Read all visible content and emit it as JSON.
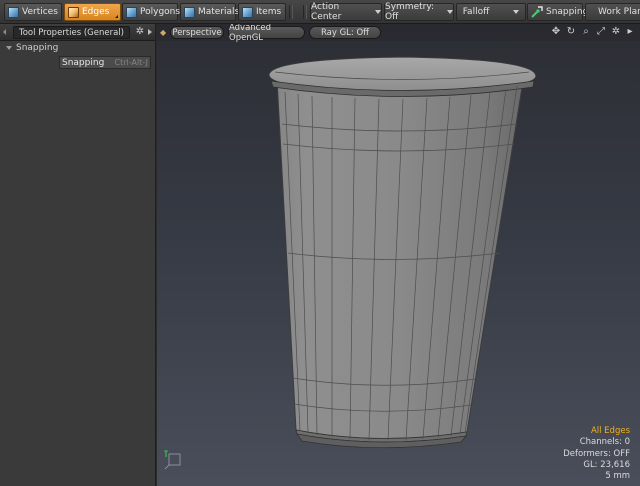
{
  "toolbar": {
    "modes": [
      {
        "label": "Vertices",
        "icon": "vertices-mode-icon",
        "active": false
      },
      {
        "label": "Edges",
        "icon": "edges-mode-icon",
        "active": true
      },
      {
        "label": "Polygons",
        "icon": "polygons-mode-icon",
        "active": false
      },
      {
        "label": "Materials",
        "icon": "materials-mode-icon",
        "active": false
      },
      {
        "label": "Items",
        "icon": "items-mode-icon",
        "active": false
      }
    ],
    "action_center": "Action Center",
    "symmetry": "Symmetry: Off",
    "falloff": "Falloff",
    "snapping": "Snapping",
    "work_plane": "Work Plane"
  },
  "panel": {
    "title": "Tool Properties (General)",
    "section": "Snapping",
    "row_label": "Snapping",
    "row_shortcut": "Ctrl-Alt-J"
  },
  "viewport": {
    "view": "Perspective",
    "shading": "Advanced OpenGL",
    "raygl": "Ray GL: Off",
    "stats": {
      "title": "All Edges",
      "channels": "Channels: 0",
      "deformers": "Deformers: OFF",
      "gl": "GL: 23,616",
      "unit": "5 mm"
    }
  },
  "colors": {
    "accent": "#e8952f",
    "stats_title": "#f0b020"
  }
}
